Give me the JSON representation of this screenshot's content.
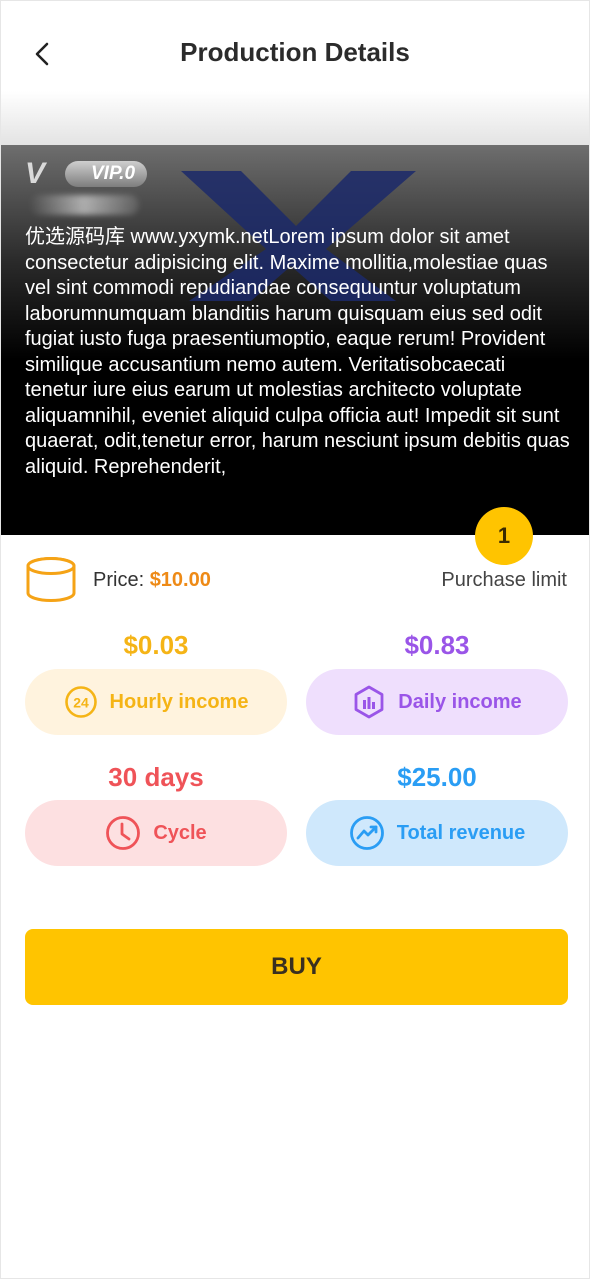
{
  "header": {
    "title": "Production Details",
    "back_icon": "chevron-left-icon"
  },
  "banner": {
    "vip_letter": "V",
    "vip_label": "VIP.0",
    "description": "优选源码库 www.yxymk.netLorem ipsum dolor sit amet consectetur adipisicing elit. Maxime mollitia,molestiae quas vel sint commodi repudiandae consequuntur voluptatum laborumnumquam blanditiis harum quisquam eius sed odit fugiat iusto fuga praesentiumoptio, eaque rerum! Provident similique accusantium nemo autem. Veritatisobcaecati tenetur iure eius earum ut molestias architecto voluptate aliquamnihil, eveniet aliquid culpa officia aut! Impedit sit sunt quaerat, odit,tenetur error, harum nesciunt ipsum debitis quas aliquid. Reprehenderit,"
  },
  "purchase": {
    "limit_count": "1",
    "limit_label": "Purchase limit",
    "price_label": "Price: ",
    "price_value": "$10.00",
    "price_icon": "coins-icon"
  },
  "stats": {
    "hourly": {
      "value": "$0.03",
      "label": "Hourly income",
      "icon": "24-hour-icon",
      "color": "#f5b416",
      "bg": "#fff3de"
    },
    "daily": {
      "value": "$0.83",
      "label": "Daily income",
      "icon": "hexagon-chart-icon",
      "color": "#9a55e8",
      "bg": "#efdffd"
    },
    "cycle": {
      "value": "30 days",
      "label": "Cycle",
      "icon": "clock-icon",
      "color": "#ef5358",
      "bg": "#fde0e1"
    },
    "revenue": {
      "value": "$25.00",
      "label": "Total revenue",
      "icon": "trend-chart-icon",
      "color": "#2a9df4",
      "bg": "#cfe8fc"
    }
  },
  "actions": {
    "buy_label": "BUY"
  }
}
